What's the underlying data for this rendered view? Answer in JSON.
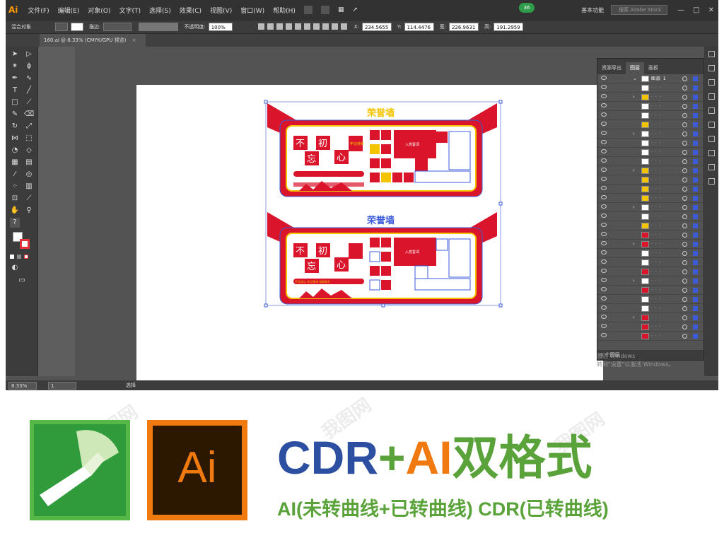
{
  "app": {
    "logo": "Ai",
    "menu": [
      "文件(F)",
      "编辑(E)",
      "对象(O)",
      "文字(T)",
      "选择(S)",
      "效果(C)",
      "视图(V)",
      "窗口(W)",
      "帮助(H)"
    ],
    "badge": "36",
    "workspace": "基本功能",
    "stock_placeholder": "搜索 Adobe Stock",
    "window_controls": [
      "—",
      "□",
      "✕"
    ]
  },
  "control_bar": {
    "object_type": "混合对象",
    "stroke_label": "描边:",
    "opacity_label": "不透明度:",
    "opacity_value": "100%",
    "x_label": "X:",
    "x_value": "234.5655",
    "y_label": "Y:",
    "y_value": "114.4476",
    "w_label": "宽:",
    "w_value": "226.9631",
    "h_label": "高:",
    "h_value": "191.2959"
  },
  "document": {
    "tab_title": "160.ai @ 8.33% (CMYK/GPU 预览)",
    "close": "×"
  },
  "status_bar": {
    "zoom": "8.33%",
    "artboard": "1",
    "tool": "选择"
  },
  "layers_panel": {
    "tabs": [
      "资源导出",
      "图层",
      "画板"
    ],
    "active_tab": "图层",
    "top_layer": "图层 1",
    "footer": "1 个图层"
  },
  "os_notice": {
    "line1": "激活 Windows",
    "line2": "转到\"设置\"以激活 Windows。"
  },
  "artwork": {
    "title_top": "荣誉墙",
    "title_bottom": "荣誉墙",
    "chars": [
      "不",
      "初",
      "忘",
      "心"
    ],
    "slogan": "牢记使命",
    "party_intro": "入党誓词",
    "tagline": "不忘初心 牢记使命 砥砺前行"
  },
  "banner": {
    "title_cdr": "CDR",
    "title_plus": "+",
    "title_ai": "AI",
    "title_rest": "双格式",
    "subtitle": "AI(未转曲线+已转曲线) CDR(已转曲线)",
    "ai_logo_text": "Ai",
    "watermark": "我图网"
  },
  "colors": {
    "ai_orange": "#f07a10",
    "cdr_green": "#2f9b3a",
    "title_blue": "#2d4fa1",
    "subtitle_green": "#5aa23a",
    "honor_red": "#d9142b",
    "honor_gold": "#f4c400"
  }
}
